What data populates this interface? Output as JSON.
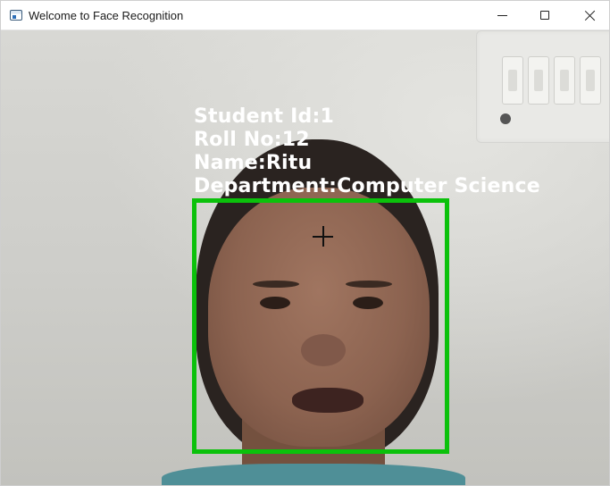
{
  "window": {
    "title": "Welcome to Face Recognition",
    "icon": "app-window-icon",
    "controls": [
      "minimize-icon",
      "maximize-icon",
      "close-icon"
    ]
  },
  "recognition": {
    "student_id": "Student Id:1",
    "roll_no": "Roll No:12",
    "name": "Name:Ritu",
    "department": "Department:Computer Science",
    "box_color": "#0bc10b",
    "text_color": "#ffffff"
  },
  "cursor": "crosshair-icon"
}
